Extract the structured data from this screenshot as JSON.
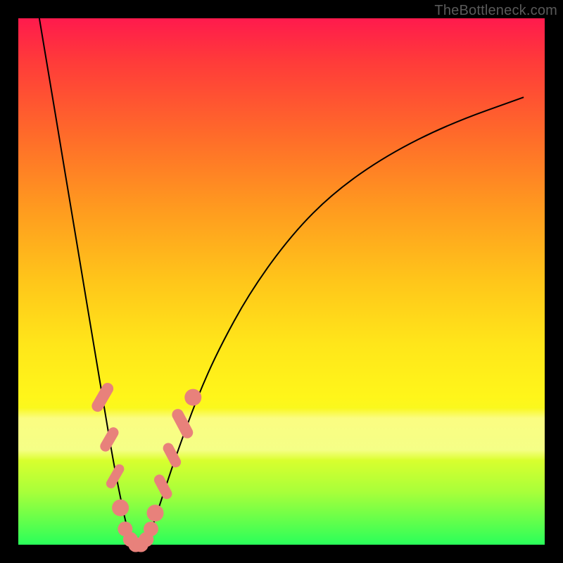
{
  "watermark": "TheBottleneck.com",
  "chart_data": {
    "type": "line",
    "title": "",
    "xlabel": "",
    "ylabel": "",
    "xlim": [
      0,
      100
    ],
    "ylim": [
      0,
      100
    ],
    "grid": false,
    "legend": false,
    "background": {
      "gradient_top": "#ff1a4d",
      "gradient_mid": "#ffe61a",
      "gradient_bottom": "#2aff5a",
      "highlight_band_y": [
        18,
        25
      ]
    },
    "series": [
      {
        "name": "bottleneck-curve",
        "color": "#000000",
        "x": [
          4,
          6,
          8,
          10,
          12,
          14,
          16,
          18,
          20,
          21,
          22,
          23,
          24,
          25,
          26,
          28,
          30,
          34,
          38,
          44,
          52,
          60,
          70,
          82,
          96
        ],
        "y": [
          100,
          88,
          76,
          64,
          52,
          40,
          28,
          16,
          6,
          2,
          0,
          0,
          0,
          2,
          5,
          11,
          17,
          28,
          37,
          48,
          59,
          67,
          74,
          80,
          85
        ]
      }
    ],
    "markers": {
      "name": "highlighted-points",
      "color": "#e8817b",
      "points": [
        {
          "x": 16,
          "y": 28,
          "shape": "roundrect",
          "w": 2.2,
          "h": 6
        },
        {
          "x": 17.3,
          "y": 20,
          "shape": "roundrect",
          "w": 2.0,
          "h": 5
        },
        {
          "x": 18.4,
          "y": 13,
          "shape": "roundrect",
          "w": 1.8,
          "h": 5
        },
        {
          "x": 19.4,
          "y": 7,
          "shape": "circle",
          "r": 1.6
        },
        {
          "x": 20.3,
          "y": 3,
          "shape": "circle",
          "r": 1.4
        },
        {
          "x": 21.3,
          "y": 1,
          "shape": "circle",
          "r": 1.4
        },
        {
          "x": 22.3,
          "y": 0,
          "shape": "circle",
          "r": 1.4
        },
        {
          "x": 23.3,
          "y": 0,
          "shape": "circle",
          "r": 1.4
        },
        {
          "x": 24.3,
          "y": 1,
          "shape": "circle",
          "r": 1.4
        },
        {
          "x": 25.2,
          "y": 3,
          "shape": "circle",
          "r": 1.4
        },
        {
          "x": 26.0,
          "y": 6,
          "shape": "circle",
          "r": 1.6
        },
        {
          "x": 27.5,
          "y": 11,
          "shape": "roundrect",
          "w": 2.0,
          "h": 5
        },
        {
          "x": 29.2,
          "y": 17,
          "shape": "roundrect",
          "w": 2.0,
          "h": 5
        },
        {
          "x": 31.2,
          "y": 23,
          "shape": "roundrect",
          "w": 2.2,
          "h": 6
        },
        {
          "x": 33.2,
          "y": 28,
          "shape": "circle",
          "r": 1.6
        }
      ]
    }
  }
}
